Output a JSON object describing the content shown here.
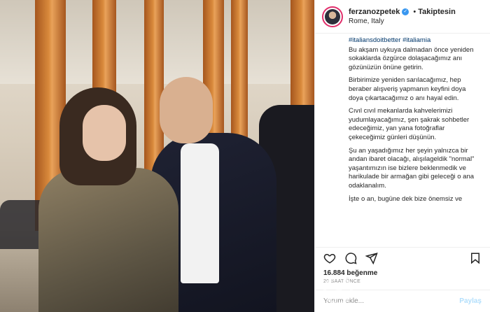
{
  "profile": {
    "username": "ferzanozpetek",
    "follow_state": "Takiptesin",
    "location": "Rome, Italy"
  },
  "caption": {
    "hashtags": "#italiansdoitbetter #italiamia",
    "paragraphs": [
      "Bu akşam uykuya dalmadan önce yeniden sokaklarda özgürce dolaşacağımız anı gözünüzün önüne getirin.",
      "Birbirimize yeniden sarılacağımız, hep beraber alışveriş yapmanın keyfini doya doya çıkartacağımız o anı hayal edin.",
      "Cıvıl cıvıl mekanlarda kahvelerimizi yudumlayacağımız, şen şakrak sohbetler edeceğimiz, yan yana fotoğraflar çekeceğimiz günleri düşünün.",
      "Şu an yaşadığımız her şeyin yalnızca bir andan ibaret olacağı, alışılageldik \"normal\" yaşantımızın ise bizlere beklenmedik ve harikulade bir armağan gibi geleceği o ana odaklanalım.",
      "İşte o an, bugüne dek bize önemsiz ve"
    ]
  },
  "likes": "16.884 beğenme",
  "time_ago": "20 SAAT ÖNCE",
  "comment": {
    "placeholder": "Yorum ekle...",
    "post_label": "Paylaş"
  },
  "icons": {
    "like": "heart-icon",
    "comment": "comment-icon",
    "share": "share-icon",
    "save": "bookmark-icon",
    "more": "more-icon"
  },
  "colors": {
    "link": "#00376b",
    "verified": "#3897f0",
    "muted": "#8e8e8e",
    "post_disabled": "#b2dffc"
  }
}
